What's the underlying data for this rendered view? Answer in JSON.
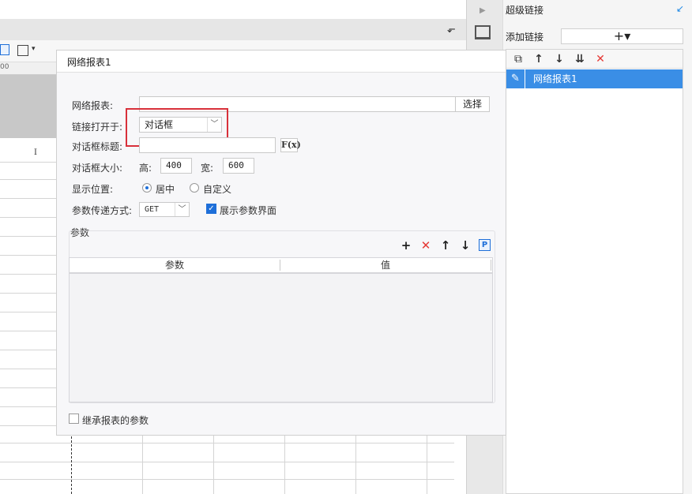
{
  "background": {
    "column_header": "I",
    "ruler_text": "00"
  },
  "right_panel": {
    "title": "超级链接",
    "add_link_label": "添加链接",
    "add_button_symbol": "+▾",
    "list_items": [
      {
        "label": "网络报表1"
      }
    ],
    "tool_icons": [
      "copy-icon",
      "arrow-up-icon",
      "arrow-down-icon",
      "sort-icon",
      "delete-icon"
    ]
  },
  "dialog": {
    "title": "网络报表1",
    "report_label": "网络报表:",
    "report_value": "",
    "select_button": "选择",
    "open_in_label": "链接打开于:",
    "open_in_value": "对话框",
    "dialog_title_label": "对话框标题:",
    "dialog_title_value": "",
    "fx_label": "F(x)",
    "dialog_size_label": "对话框大小:",
    "height_label": "高:",
    "height_value": "400",
    "width_label": "宽:",
    "width_value": "600",
    "position_label": "显示位置:",
    "position_options": [
      {
        "label": "居中",
        "selected": true
      },
      {
        "label": "自定义",
        "selected": false
      }
    ],
    "method_label": "参数传递方式:",
    "method_value": "GET",
    "show_param_checkbox": {
      "label": "展示参数界面",
      "checked": true
    },
    "params_group_label": "参数",
    "params_table": {
      "columns": [
        "参数",
        "值"
      ],
      "rows": []
    },
    "inherit_checkbox": {
      "label": "继承报表的参数",
      "checked": false
    }
  },
  "colors": {
    "accent": "#3a8ee6",
    "highlight_border": "#d8303a",
    "delete_red": "#e53935"
  }
}
